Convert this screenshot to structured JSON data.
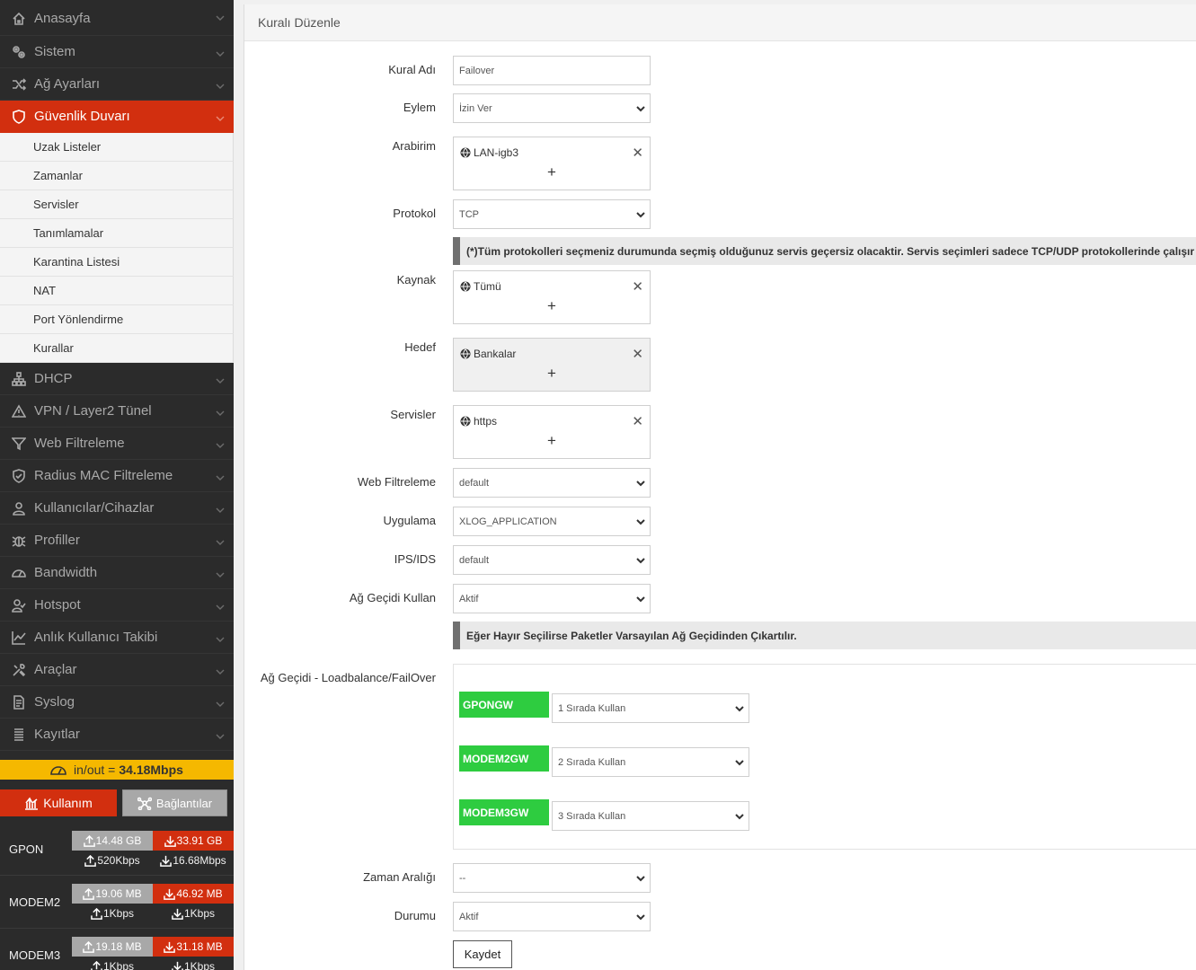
{
  "sidebar": {
    "items": [
      {
        "label": "Anasayfa",
        "icon": "home-icon"
      },
      {
        "label": "Sistem",
        "icon": "gears-icon"
      },
      {
        "label": "Ağ Ayarları",
        "icon": "shuffle-icon"
      },
      {
        "label": "Güvenlik Duvarı",
        "icon": "shield-icon",
        "active": true
      },
      {
        "label": "DHCP",
        "icon": "network-icon"
      },
      {
        "label": "VPN / Layer2 Tünel",
        "icon": "warning-icon"
      },
      {
        "label": "Web Filtreleme",
        "icon": "filter-icon"
      },
      {
        "label": "Radius MAC Filtreleme",
        "icon": "shield-check-icon"
      },
      {
        "label": "Kullanıcılar/Cihazlar",
        "icon": "user-icon"
      },
      {
        "label": "Profiller",
        "icon": "bug-icon"
      },
      {
        "label": "Bandwidth",
        "icon": "gauge-icon"
      },
      {
        "label": "Hotspot",
        "icon": "user-check-icon"
      },
      {
        "label": "Anlık Kullanıcı Takibi",
        "icon": "chart-line-icon"
      },
      {
        "label": "Araçlar",
        "icon": "tools-icon"
      },
      {
        "label": "Syslog",
        "icon": "doc-icon"
      },
      {
        "label": "Kayıtlar",
        "icon": "list-icon"
      }
    ],
    "subitems": [
      "Uzak Listeler",
      "Zamanlar",
      "Servisler",
      "Tanımlamalar",
      "Karantina Listesi",
      "NAT",
      "Port Yönlendirme",
      "Kurallar"
    ],
    "inout": {
      "label": "in/out =",
      "value": "34.18Mbps"
    },
    "tabs": {
      "usage": "Kullanım",
      "connections": "Bağlantılar"
    },
    "wans": [
      {
        "name": "GPON",
        "up_total": "14.48 GB",
        "down_total": "33.91 GB",
        "up_rate": "520Kbps",
        "down_rate": "16.68Mbps"
      },
      {
        "name": "MODEM2",
        "up_total": "19.06 MB",
        "down_total": "46.92 MB",
        "up_rate": "1Kbps",
        "down_rate": "1Kbps"
      },
      {
        "name": "MODEM3",
        "up_total": "19.18 MB",
        "down_total": "31.18 MB",
        "up_rate": "1Kbps",
        "down_rate": "1Kbps"
      }
    ]
  },
  "main": {
    "title": "Kuralı Düzenle",
    "labels": {
      "rule_name": "Kural Adı",
      "action": "Eylem",
      "interface": "Arabirim",
      "protocol": "Protokol",
      "source": "Kaynak",
      "destination": "Hedef",
      "services": "Servisler",
      "web_filter": "Web Filtreleme",
      "application": "Uygulama",
      "ips": "IPS/IDS",
      "use_gateway": "Ağ Geçidi Kullan",
      "gateway_lb": "Ağ Geçidi - Loadbalance/FailOver",
      "time_range": "Zaman Aralığı",
      "status": "Durumu"
    },
    "values": {
      "rule_name": "Failover",
      "action": "İzin Ver",
      "interface_tag": "LAN-igb3",
      "protocol": "TCP",
      "source_tag": "Tümü",
      "destination_tag": "Bankalar",
      "services_tag": "https",
      "web_filter": "default",
      "application": "XLOG_APPLICATION",
      "ips": "default",
      "use_gateway": "Aktif",
      "time_range": "--",
      "status": "Aktif"
    },
    "tag_remove": "✕",
    "tag_add": "+",
    "notice_protocol": "(*)Tüm protokolleri seçmeniz durumunda seçmiş olduğunuz servis geçersiz olacaktir. Servis seçimleri sadece TCP/UDP protokollerinde çalışır",
    "notice_gateway": "Eğer Hayır Seçilirse Paketler Varsayılan Ağ Geçidinden Çıkartılır.",
    "gateways": [
      {
        "name": "GPONGW",
        "order": "1 Sırada Kullan"
      },
      {
        "name": "MODEM2GW",
        "order": "2 Sırada Kullan"
      },
      {
        "name": "MODEM3GW",
        "order": "3 Sırada Kullan"
      }
    ],
    "save": "Kaydet"
  },
  "colors": {
    "accent": "#d22f0f",
    "sidebar_bg": "#2b2b2b",
    "gateway_badge": "#2ecc40",
    "inout_bar": "#f5b800"
  }
}
